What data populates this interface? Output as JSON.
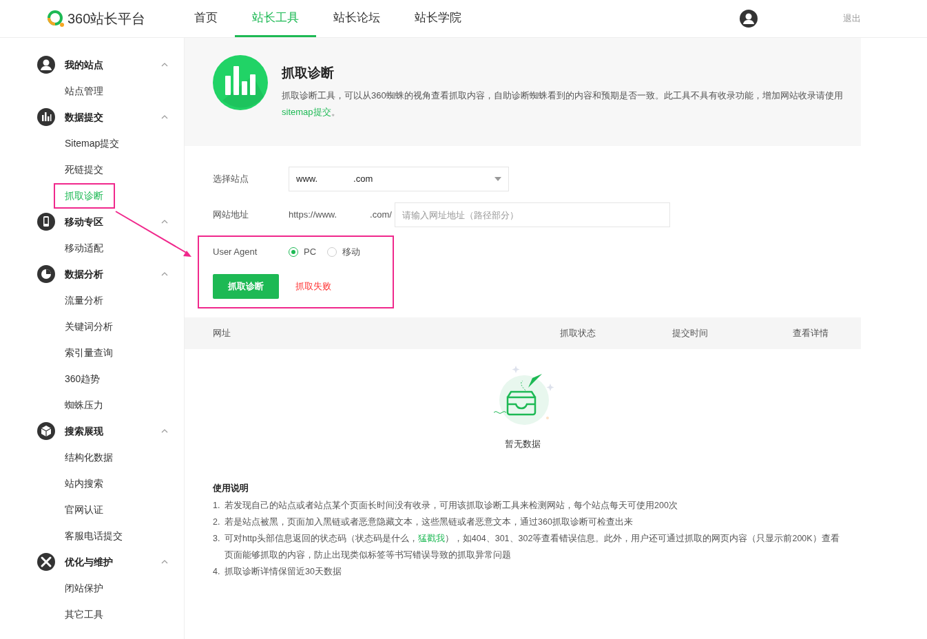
{
  "header": {
    "logo_text": "360站长平台",
    "nav": [
      {
        "label": "首页",
        "selected": false
      },
      {
        "label": "站长工具",
        "selected": true
      },
      {
        "label": "站长论坛",
        "selected": false
      },
      {
        "label": "站长学院",
        "selected": false
      }
    ],
    "logout": "退出"
  },
  "sidebar": [
    {
      "kind": "user",
      "title": "我的站点",
      "expanded": true,
      "items": [
        {
          "label": "站点管理",
          "selected": false
        }
      ]
    },
    {
      "kind": "bars",
      "title": "数据提交",
      "expanded": true,
      "items": [
        {
          "label": "Sitemap提交",
          "selected": false
        },
        {
          "label": "死链提交",
          "selected": false
        },
        {
          "label": "抓取诊断",
          "selected": true
        }
      ]
    },
    {
      "kind": "phone",
      "title": "移动专区",
      "expanded": true,
      "items": [
        {
          "label": "移动适配",
          "selected": false
        }
      ]
    },
    {
      "kind": "pie",
      "title": "数据分析",
      "expanded": true,
      "items": [
        {
          "label": "流量分析",
          "selected": false
        },
        {
          "label": "关键词分析",
          "selected": false
        },
        {
          "label": "索引量查询",
          "selected": false
        },
        {
          "label": "360趋势",
          "selected": false
        },
        {
          "label": "蜘蛛压力",
          "selected": false
        }
      ]
    },
    {
      "kind": "cube",
      "title": "搜索展现",
      "expanded": true,
      "items": [
        {
          "label": "结构化数据",
          "selected": false
        },
        {
          "label": "站内搜索",
          "selected": false
        },
        {
          "label": "官网认证",
          "selected": false
        },
        {
          "label": "客服电话提交",
          "selected": false
        }
      ]
    },
    {
      "kind": "tools",
      "title": "优化与维护",
      "expanded": true,
      "items": [
        {
          "label": "闭站保护",
          "selected": false
        },
        {
          "label": "其它工具",
          "selected": false
        }
      ]
    }
  ],
  "intro": {
    "title": "抓取诊断",
    "text_before": "抓取诊断工具，可以从360蜘蛛的视角查看抓取内容，自助诊断蜘蛛看到的内容和预期是否一致。此工具不具有收录功能，增加网站收录请使用",
    "link": "sitemap提交",
    "text_after": "。"
  },
  "form": {
    "site_label": "选择站点",
    "site_value_start": "www.",
    "site_value_end": ".com",
    "url_label": "网站地址",
    "url_prefix_start": "https://www.",
    "url_prefix_end": ".com/",
    "url_placeholder": "请输入网址地址（路径部分）",
    "ua_label": "User Agent",
    "ua_options": [
      {
        "label": "PC",
        "selected": true
      },
      {
        "label": "移动",
        "selected": false
      }
    ],
    "submit": "抓取诊断",
    "status": "抓取失败"
  },
  "table": {
    "columns": [
      "网址",
      "抓取状态",
      "提交时间",
      "查看详情"
    ],
    "empty_text": "暂无数据"
  },
  "instructions": {
    "title": "使用说明",
    "items": [
      {
        "number": "1.",
        "text": "若发现自己的站点或者站点某个页面长时间没有收录，可用该抓取诊断工具来检测网站，每个站点每天可使用200次"
      },
      {
        "number": "2.",
        "text": "若是站点被黑，页面加入黑链或者恶意隐藏文本，这些黑链或者恶意文本，通过360抓取诊断可检查出来"
      },
      {
        "number": "3.",
        "text": "可对http头部信息返回的状态码（状态码是什么，",
        "link": "猛戳我",
        "text_after": "），如404、301、302等查看错误信息。此外，用户还可通过抓取的网页内容（只显示前200K）查看页面能够抓取的内容，防止出现类似标签等书写错误导致的抓取异常问题"
      },
      {
        "number": "4.",
        "text": "抓取诊断详情保留近30天数据"
      }
    ]
  }
}
